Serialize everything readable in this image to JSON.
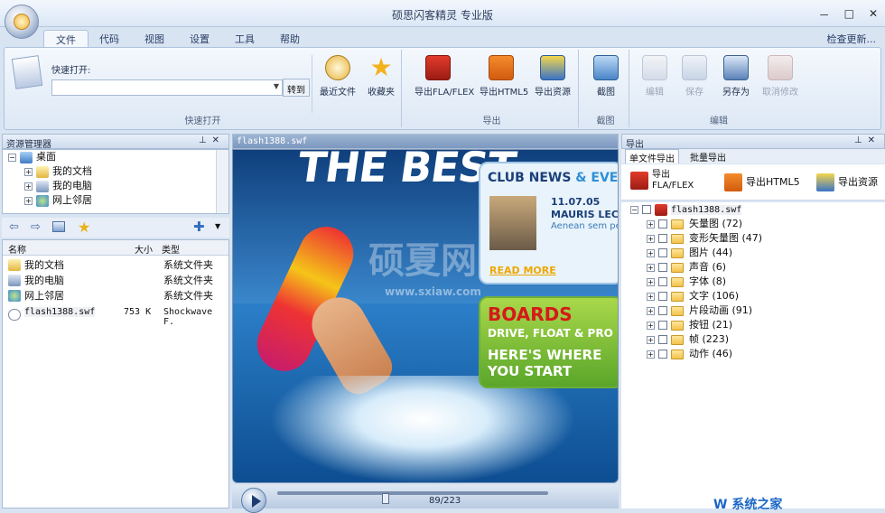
{
  "window": {
    "title": "硕思闪客精灵 专业版",
    "min": "－",
    "max": "□",
    "close": "✕"
  },
  "menu_tabs": [
    "文件",
    "代码",
    "视图",
    "设置",
    "工具",
    "帮助"
  ],
  "update_link": "检查更新...",
  "ribbon": {
    "quick_open_label": "快速打开:",
    "goto_label": "转到",
    "recent_label": "最近文件",
    "favorites_label": "收藏夹",
    "group_quick_open": "快速打开",
    "export_fla": "导出FLA/FLEX",
    "export_html5": "导出HTML5",
    "export_resources": "导出资源",
    "group_export": "导出",
    "screenshot": "截图",
    "group_screenshot": "截图",
    "edit": "编辑",
    "save": "保存",
    "save_as": "另存为",
    "cancel_edit": "取消修改",
    "group_edit": "编辑"
  },
  "explorer": {
    "title": "资源管理器",
    "tree": [
      {
        "label": "桌面",
        "level": 0,
        "sign": "−"
      },
      {
        "label": "我的文档",
        "level": 1,
        "sign": "+"
      },
      {
        "label": "我的电脑",
        "level": 1,
        "sign": "+"
      },
      {
        "label": "网上邻居",
        "level": 1,
        "sign": "+"
      }
    ],
    "columns": [
      "名称",
      "大小",
      "类型"
    ],
    "rows": [
      {
        "name": "我的文档",
        "size": "",
        "type": "系统文件夹"
      },
      {
        "name": "我的电脑",
        "size": "",
        "type": "系统文件夹"
      },
      {
        "name": "网上邻居",
        "size": "",
        "type": "系统文件夹"
      },
      {
        "name": "flash1388.swf",
        "size": "753 K",
        "type": "Shockwave F."
      }
    ]
  },
  "preview": {
    "tab": "flash1388.swf",
    "headline": "THE BEST",
    "club": "CLUB NEWS",
    "events": "& EVENTS",
    "date": "11.07.05",
    "mauris": "MAURIS LECT",
    "body": "Aenean sem pe posuere in, soll non, consequat",
    "read_more": "READ MORE",
    "boards": "BOARDS",
    "boards_sub": "DRIVE, FLOAT & PRO",
    "cta": "HERE'S WHERE YOU START",
    "watermark": "硕夏网",
    "watermark_url": "www.sxiaw.com",
    "frame": "89/223",
    "frame_progress": 0.399
  },
  "export_panel": {
    "title": "导出",
    "tab_single": "单文件导出",
    "tab_batch": "批量导出",
    "btn_fla": "导出 FLA/FLEX",
    "btn_html5": "导出HTML5",
    "btn_res": "导出资源",
    "root": "flash1388.swf",
    "items": [
      {
        "label": "矢量图",
        "count": "(72)"
      },
      {
        "label": "变形矢量图",
        "count": "(47)"
      },
      {
        "label": "图片",
        "count": "(44)"
      },
      {
        "label": "声音",
        "count": "(6)"
      },
      {
        "label": "字体",
        "count": "(8)"
      },
      {
        "label": "文字",
        "count": "(106)"
      },
      {
        "label": "片段动画",
        "count": "(91)"
      },
      {
        "label": "按钮",
        "count": "(21)"
      },
      {
        "label": "帧",
        "count": "(223)"
      },
      {
        "label": "动作",
        "count": "(46)"
      }
    ]
  },
  "brand_corner": "W 系统之家"
}
